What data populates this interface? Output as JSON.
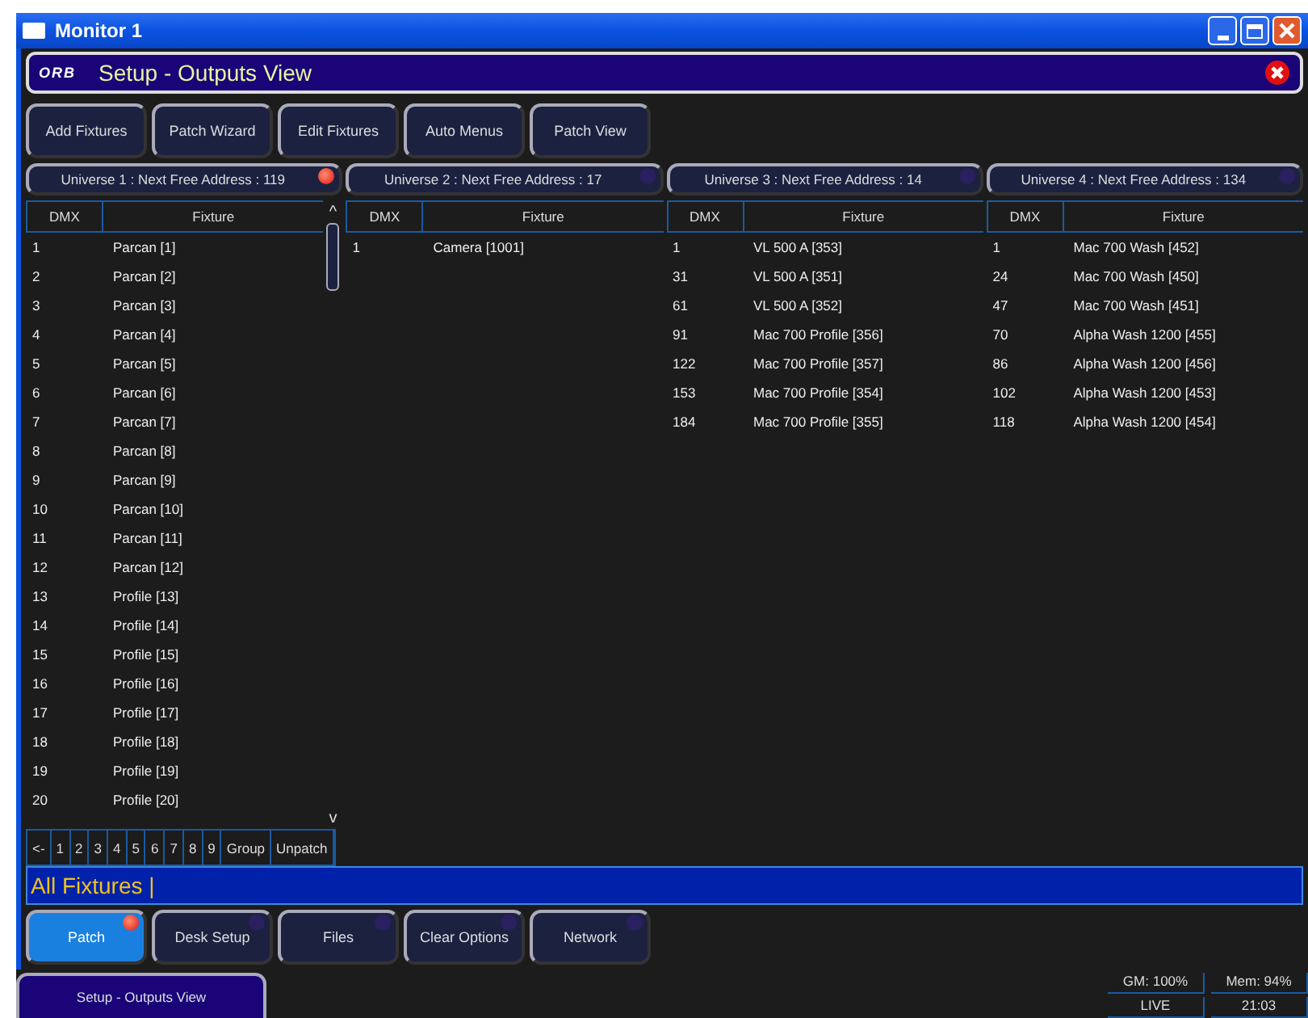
{
  "window": {
    "title": "Monitor 1"
  },
  "header": {
    "logo": "ORB",
    "title": "Setup - Outputs View"
  },
  "toolbar": [
    "Add Fixtures",
    "Patch Wizard",
    "Edit Fixtures",
    "Auto Menus",
    "Patch View"
  ],
  "universes": [
    {
      "label": "Universe 1 : Next Free Address : 119",
      "active": true,
      "scrollbar": true,
      "columns": [
        "DMX",
        "Fixture"
      ],
      "rows": [
        [
          "1",
          "Parcan [1]"
        ],
        [
          "2",
          "Parcan [2]"
        ],
        [
          "3",
          "Parcan [3]"
        ],
        [
          "4",
          "Parcan [4]"
        ],
        [
          "5",
          "Parcan [5]"
        ],
        [
          "6",
          "Parcan [6]"
        ],
        [
          "7",
          "Parcan [7]"
        ],
        [
          "8",
          "Parcan [8]"
        ],
        [
          "9",
          "Parcan [9]"
        ],
        [
          "10",
          "Parcan [10]"
        ],
        [
          "11",
          "Parcan [11]"
        ],
        [
          "12",
          "Parcan [12]"
        ],
        [
          "13",
          "Profile [13]"
        ],
        [
          "14",
          "Profile [14]"
        ],
        [
          "15",
          "Profile [15]"
        ],
        [
          "16",
          "Profile [16]"
        ],
        [
          "17",
          "Profile [17]"
        ],
        [
          "18",
          "Profile [18]"
        ],
        [
          "19",
          "Profile [19]"
        ],
        [
          "20",
          "Profile [20]"
        ]
      ],
      "scroll_up": "^",
      "scroll_down": "v"
    },
    {
      "label": "Universe 2 : Next Free Address : 17",
      "active": false,
      "scrollbar": false,
      "columns": [
        "DMX",
        "Fixture"
      ],
      "rows": [
        [
          "1",
          "Camera [1001]"
        ]
      ]
    },
    {
      "label": "Universe 3 : Next Free Address : 14",
      "active": false,
      "scrollbar": false,
      "columns": [
        "DMX",
        "Fixture"
      ],
      "rows": [
        [
          "1",
          "VL 500 A [353]"
        ],
        [
          "31",
          "VL 500 A [351]"
        ],
        [
          "61",
          "VL 500 A [352]"
        ],
        [
          "91",
          "Mac 700 Profile [356]"
        ],
        [
          "122",
          "Mac 700 Profile [357]"
        ],
        [
          "153",
          "Mac 700 Profile [354]"
        ],
        [
          "184",
          "Mac 700 Profile [355]"
        ]
      ]
    },
    {
      "label": "Universe 4 : Next Free Address : 134",
      "active": false,
      "scrollbar": false,
      "columns": [
        "DMX",
        "Fixture"
      ],
      "rows": [
        [
          "1",
          "Mac 700 Wash [452]"
        ],
        [
          "24",
          "Mac 700 Wash [450]"
        ],
        [
          "47",
          "Mac 700 Wash [451]"
        ],
        [
          "70",
          "Alpha Wash 1200 [455]"
        ],
        [
          "86",
          "Alpha Wash 1200 [456]"
        ],
        [
          "102",
          "Alpha Wash 1200 [453]"
        ],
        [
          "118",
          "Alpha Wash 1200 [454]"
        ]
      ]
    }
  ],
  "keypad": [
    "<-",
    "1",
    "2",
    "3",
    "4",
    "5",
    "6",
    "7",
    "8",
    "9",
    "Group",
    "Unpatch"
  ],
  "command_line": "All Fixtures |",
  "bottom_tabs": [
    {
      "label": "Patch",
      "selected": true
    },
    {
      "label": "Desk Setup",
      "selected": false
    },
    {
      "label": "Files",
      "selected": false
    },
    {
      "label": "Clear Options",
      "selected": false
    },
    {
      "label": "Network",
      "selected": false
    }
  ],
  "taskbar": {
    "window": "Setup - Outputs View",
    "status": [
      "GM: 100%",
      "Mem: 94%",
      "LIVE",
      "21:03"
    ]
  }
}
